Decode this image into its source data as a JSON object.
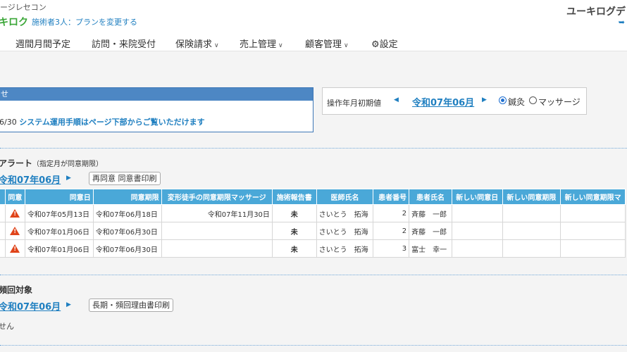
{
  "header": {
    "app_name": "ージレセコン",
    "logo_text": "キロク",
    "plan_text": "施術者3人：プランを変更する",
    "user_name": "ユーキログデ"
  },
  "nav": [
    {
      "label": "週間月間予定"
    },
    {
      "label": "訪問・来院受付"
    },
    {
      "label": "保険請求"
    },
    {
      "label": "売上管理"
    },
    {
      "label": "顧客管理"
    },
    {
      "label": "設定"
    }
  ],
  "notice": {
    "title": "せ",
    "date": "6/30",
    "link_text": "システム運用手順はページ下部からご覧いただけます"
  },
  "period": {
    "label": "操作年月初期値",
    "month": "令和07年06月",
    "options": [
      "鍼灸",
      "マッサージ"
    ],
    "selected": "鍼灸"
  },
  "alert": {
    "title": "アラート",
    "subtitle": "（指定月が同意期限）",
    "month": "令和07年06月",
    "button_label": "再同意 同意書印刷",
    "columns": [
      "同意",
      "同意日",
      "同意期限",
      "変形徒手の同意期限マッサージ",
      "施術報告書",
      "医師氏名",
      "患者番号",
      "患者氏名",
      "新しい同意日",
      "新しい同意期限",
      "新しい同意期限マ"
    ],
    "rows": [
      {
        "consent_date": "令和07年05月13日",
        "deadline": "令和07年06月18日",
        "massage_deadline": "令和07年11月30日",
        "report": "未",
        "doctor": "さいとう　拓海",
        "patient_no": "2",
        "patient_name": "斉藤　一郎"
      },
      {
        "consent_date": "令和07年01月06日",
        "deadline": "令和07年06月30日",
        "massage_deadline": "",
        "report": "未",
        "doctor": "さいとう　拓海",
        "patient_no": "2",
        "patient_name": "斉藤　一郎"
      },
      {
        "consent_date": "令和07年01月06日",
        "deadline": "令和07年06月30日",
        "massage_deadline": "",
        "report": "未",
        "doctor": "さいとう　拓海",
        "patient_no": "3",
        "patient_name": "富士　幸一"
      }
    ]
  },
  "longterm": {
    "title": "頻回対象",
    "month": "令和07年06月",
    "button_label": "長期・頻回理由書印刷",
    "empty_text": "せん"
  }
}
